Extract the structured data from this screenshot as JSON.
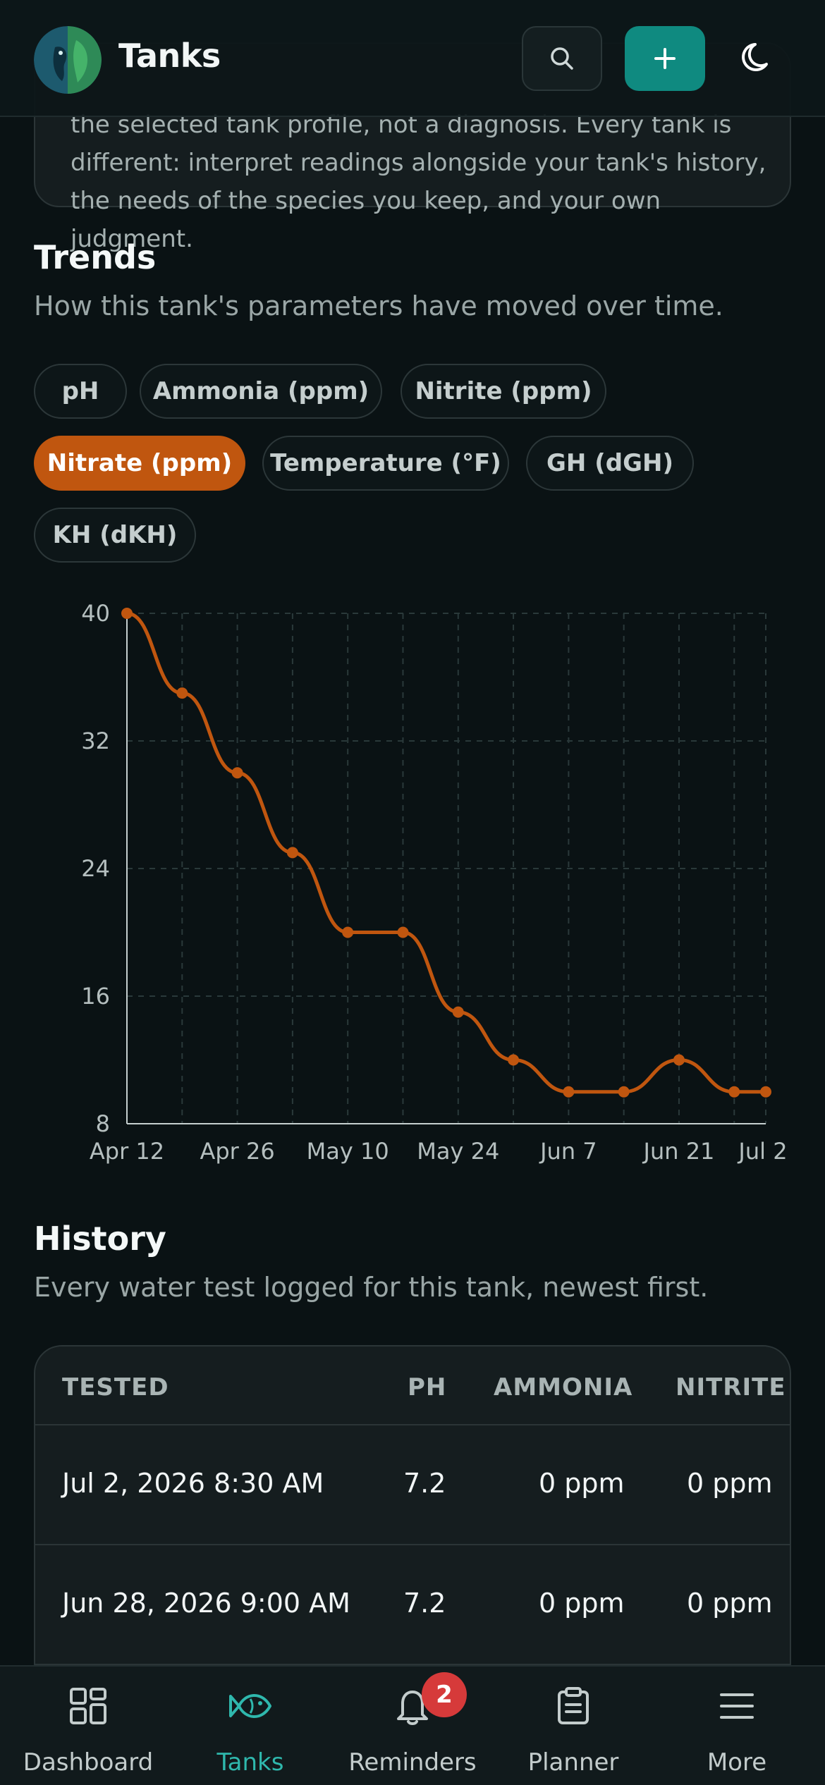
{
  "header": {
    "title": "Tanks",
    "icons": {
      "logo": "fish-leaf-logo",
      "search": "search-icon",
      "add": "plus-icon",
      "theme": "moon-icon"
    }
  },
  "disclaimer": {
    "text": "the selected tank profile, not a diagnosis. Every tank is different: interpret readings alongside your tank's history, the needs of the species you keep, and your own judgment."
  },
  "trends": {
    "title": "Trends",
    "subtitle": "How this tank's parameters have moved over time.",
    "chips": [
      "pH",
      "Ammonia (ppm)",
      "Nitrite (ppm)",
      "Nitrate (ppm)",
      "Temperature (°F)",
      "GH (dGH)",
      "KH (dKH)"
    ],
    "active_chip": "Nitrate (ppm)"
  },
  "chart_data": {
    "type": "line",
    "x_ticks": [
      "Apr 12",
      "Apr 26",
      "May 10",
      "May 24",
      "Jun 7",
      "Jun 21",
      "Jul 2"
    ],
    "y_ticks": [
      8,
      16,
      24,
      32,
      40
    ],
    "ylim": [
      8,
      40
    ],
    "xlim": [
      "2026-04-12",
      "2026-07-02"
    ],
    "grid": true,
    "series": [
      {
        "color": "#c0560f",
        "points": [
          {
            "x": "2026-04-12",
            "y": 40
          },
          {
            "x": "2026-04-19",
            "y": 35
          },
          {
            "x": "2026-04-26",
            "y": 30
          },
          {
            "x": "2026-05-03",
            "y": 25
          },
          {
            "x": "2026-05-10",
            "y": 20
          },
          {
            "x": "2026-05-17",
            "y": 20
          },
          {
            "x": "2026-05-24",
            "y": 15
          },
          {
            "x": "2026-05-31",
            "y": 12
          },
          {
            "x": "2026-06-07",
            "y": 10
          },
          {
            "x": "2026-06-14",
            "y": 10
          },
          {
            "x": "2026-06-21",
            "y": 12
          },
          {
            "x": "2026-06-28",
            "y": 10
          },
          {
            "x": "2026-07-02",
            "y": 10
          }
        ]
      }
    ]
  },
  "history": {
    "title": "History",
    "subtitle": "Every water test logged for this tank, newest first.",
    "columns": [
      "TESTED",
      "PH",
      "AMMONIA",
      "NITRITE"
    ],
    "rows": [
      [
        "Jul 2, 2026 8:30 AM",
        "7.2",
        "0 ppm",
        "0 ppm"
      ],
      [
        "Jun 28, 2026 9:00 AM",
        "7.2",
        "0 ppm",
        "0 ppm"
      ]
    ]
  },
  "nav": {
    "items": [
      {
        "label": "Dashboard",
        "icon": "dashboard-grid-icon"
      },
      {
        "label": "Tanks",
        "icon": "fish-icon"
      },
      {
        "label": "Reminders",
        "icon": "bell-icon",
        "badge": "2"
      },
      {
        "label": "Planner",
        "icon": "clipboard-icon"
      },
      {
        "label": "More",
        "icon": "menu-icon"
      }
    ],
    "active": "Tanks"
  },
  "colors": {
    "accent": "#0f8a80",
    "series": "#c0560f",
    "badge": "#d63a3a",
    "active_nav": "#2fb8ad"
  }
}
